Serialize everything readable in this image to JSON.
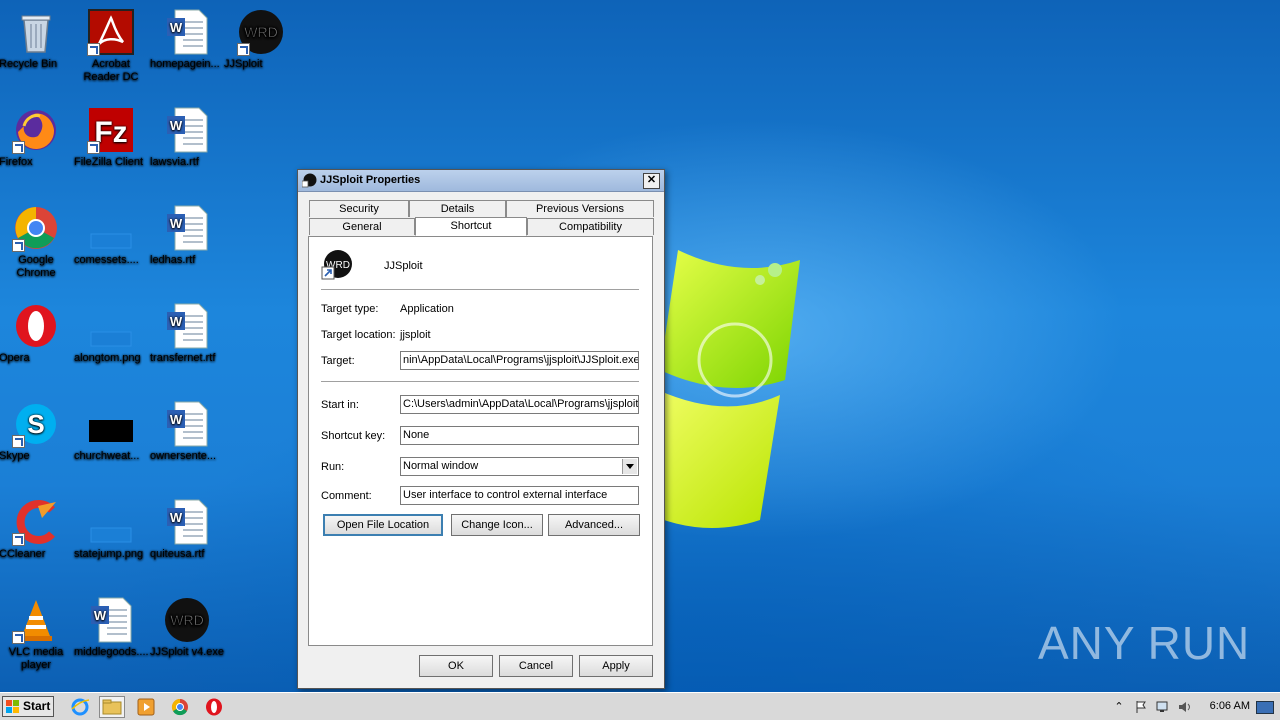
{
  "desktop": {
    "icons": [
      {
        "label": "Recycle Bin",
        "icon": "recycle-bin-icon"
      },
      {
        "label": "Acrobat Reader DC",
        "icon": "acrobat-icon"
      },
      {
        "label": "homepagein...",
        "icon": "word-doc-icon"
      },
      {
        "label": "JJSploit",
        "icon": "jjsploit-icon"
      },
      {
        "label": "Firefox",
        "icon": "firefox-icon"
      },
      {
        "label": "FileZilla Client",
        "icon": "filezilla-icon"
      },
      {
        "label": "lawsvia.rtf",
        "icon": "word-doc-icon"
      },
      {
        "label": "Google Chrome",
        "icon": "chrome-icon"
      },
      {
        "label": "comessets....",
        "icon": "blank-file-icon"
      },
      {
        "label": "ledhas.rtf",
        "icon": "word-doc-icon"
      },
      {
        "label": "Opera",
        "icon": "opera-icon"
      },
      {
        "label": "alongtom.png",
        "icon": "blank-file-icon"
      },
      {
        "label": "transfernet.rtf",
        "icon": "word-doc-icon"
      },
      {
        "label": "Skype",
        "icon": "skype-icon"
      },
      {
        "label": "churchweat...",
        "icon": "black-image-icon"
      },
      {
        "label": "ownersente...",
        "icon": "word-doc-icon"
      },
      {
        "label": "CCleaner",
        "icon": "ccleaner-icon"
      },
      {
        "label": "statejump.png",
        "icon": "blank-file-icon"
      },
      {
        "label": "quiteusa.rtf",
        "icon": "word-doc-icon"
      },
      {
        "label": "VLC media player",
        "icon": "vlc-icon"
      },
      {
        "label": "middlegoods....",
        "icon": "word-doc-icon"
      },
      {
        "label": "JJSploit v4.exe",
        "icon": "jjsploit-icon"
      }
    ],
    "watermark": {
      "left": "ANY",
      "right": "RUN"
    }
  },
  "dialog": {
    "title": "JJSploit Properties",
    "close": "✕",
    "tabs": {
      "security": "Security",
      "details": "Details",
      "previous_versions": "Previous Versions",
      "general": "General",
      "shortcut": "Shortcut",
      "compatibility": "Compatibility"
    },
    "shortcut_name": "JJSploit",
    "target_type_label": "Target type:",
    "target_type_value": "Application",
    "target_location_label": "Target location:",
    "target_location_value": "jjsploit",
    "target_label": "Target:",
    "target_value": "nin\\AppData\\Local\\Programs\\jjsploit\\JJSploit.exe",
    "start_in_label": "Start in:",
    "start_in_value": "C:\\Users\\admin\\AppData\\Local\\Programs\\jjsploit",
    "shortcut_key_label": "Shortcut key:",
    "shortcut_key_value": "None",
    "run_label": "Run:",
    "run_value": "Normal window",
    "comment_label": "Comment:",
    "comment_value": "User interface to control external interface",
    "open_file_location": "Open File Location",
    "change_icon": "Change Icon...",
    "advanced": "Advanced...",
    "ok": "OK",
    "cancel": "Cancel",
    "apply": "Apply"
  },
  "taskbar": {
    "start_label": "Start",
    "pinned": [
      "internet-explorer-icon",
      "explorer-folder-icon",
      "media-player-icon",
      "chrome-icon",
      "opera-icon"
    ],
    "clock": "6:06 AM"
  },
  "colors": {
    "desktop_blue": "#1a7ad4",
    "titlebar": "#bcd1ec",
    "default_button_border": "#3c7fb1"
  }
}
